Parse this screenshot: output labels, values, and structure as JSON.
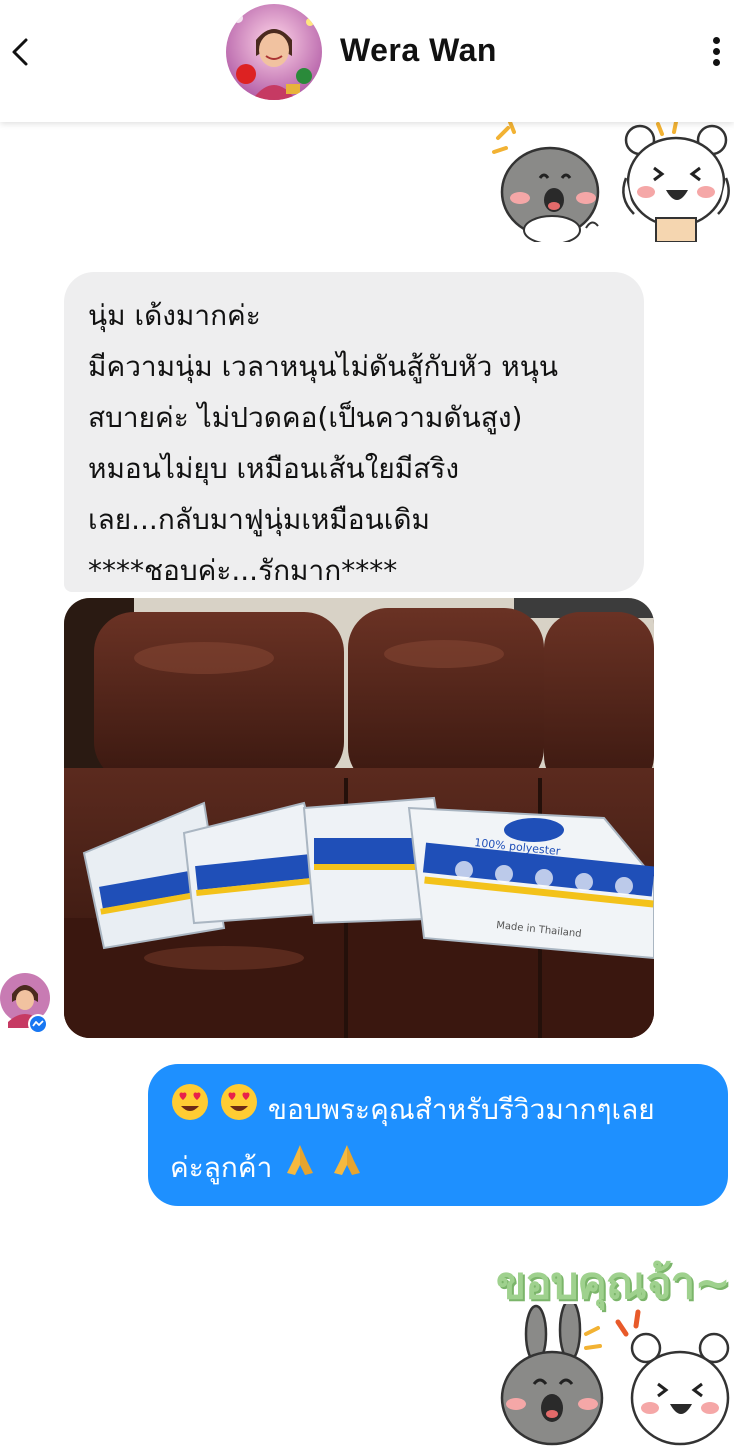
{
  "header": {
    "contact_name": "Wera Wan",
    "back_icon": "chevron-left-icon",
    "menu_icon": "more-vertical-icon"
  },
  "messages": [
    {
      "type": "received-text",
      "lines": [
        "นุ่ม เด้งมากค่ะ",
        "มีความนุ่ม เวลาหนุนไม่ดันสู้กับหัว  หนุน",
        "สบายค่ะ ไม่ปวดคอ(เป็นความดันสูง)",
        "หมอนไม่ยุบ เหมือนเส้นใยมีสริง",
        "เลย...กลับมาฟูนุ่มเหมือนเดิม",
        "****ชอบค่ะ...รักมาก****"
      ]
    },
    {
      "type": "received-photo",
      "pillow_label": "100% polyester",
      "pillow_origin": "Made in Thailand"
    },
    {
      "type": "sent-text",
      "line1": "ขอบพระคุณสำหรับรีวิวมากๆเลย",
      "line2": "ค่ะลูกค้า"
    }
  ],
  "sticker_caption": "ขอบคุณจ้า~",
  "colors": {
    "sent_bubble": "#1e90ff",
    "received_bubble": "#eeeeef",
    "messenger_badge": "#1877f2"
  }
}
